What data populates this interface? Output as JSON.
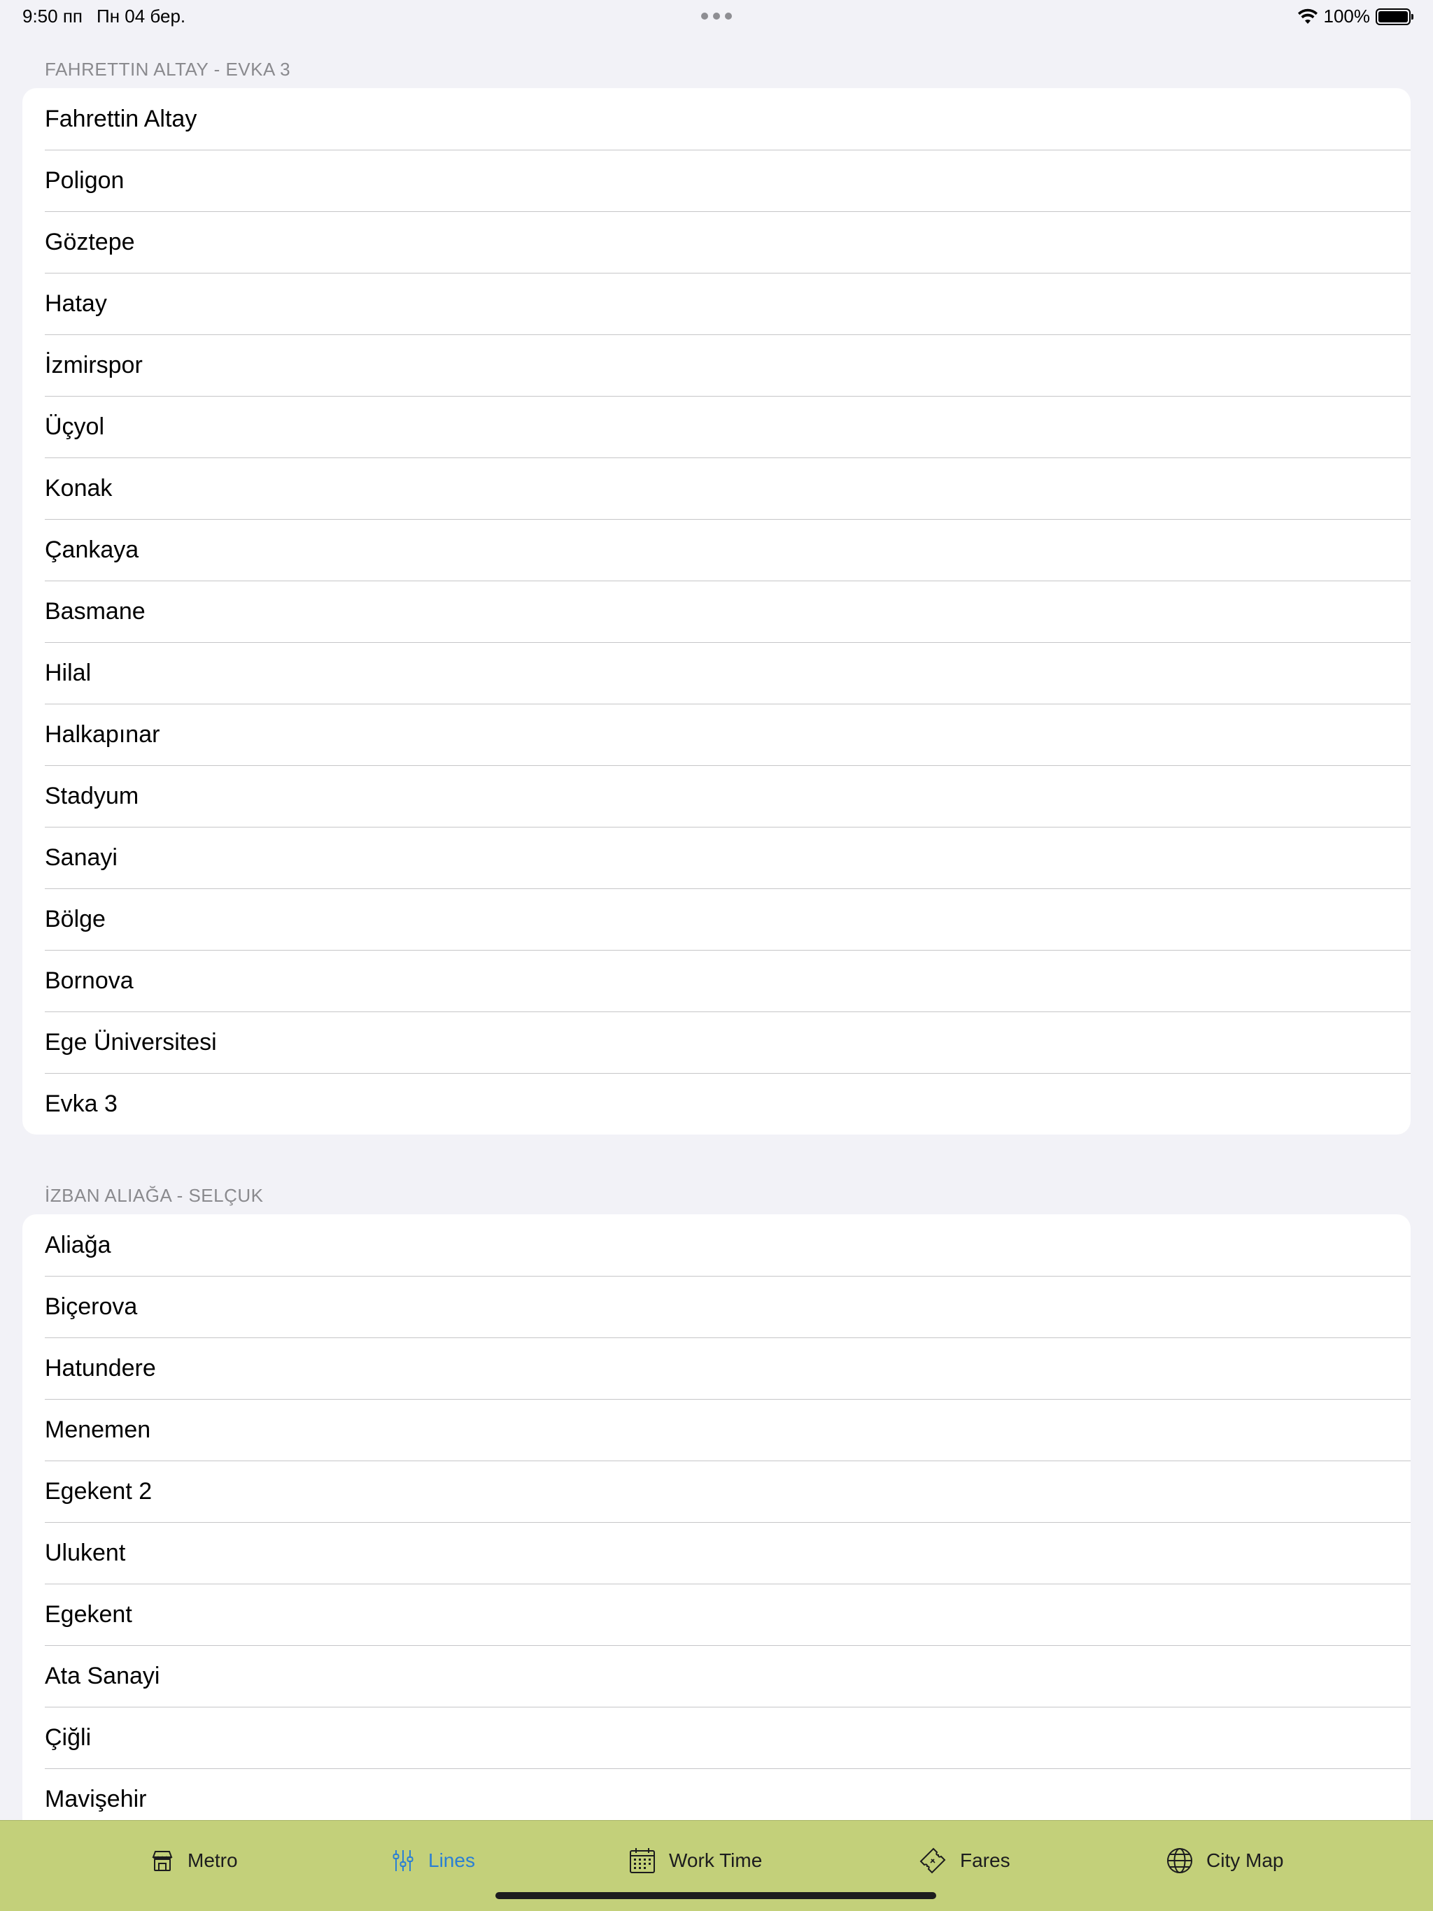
{
  "status_bar": {
    "time": "9:50 пп",
    "date": "Пн 04 бер.",
    "battery_text": "100%"
  },
  "sections": [
    {
      "header": "FAHRETTIN ALTAY - EVKA 3",
      "stations": [
        "Fahrettin Altay",
        "Poligon",
        "Göztepe",
        "Hatay",
        "İzmirspor",
        "Üçyol",
        "Konak",
        "Çankaya",
        "Basmane",
        "Hilal",
        "Halkapınar",
        "Stadyum",
        "Sanayi",
        "Bölge",
        "Bornova",
        "Ege Üniversitesi",
        "Evka 3"
      ]
    },
    {
      "header": "İZBAN ALIAĞA - SELÇUK",
      "stations": [
        "Aliağa",
        "Biçerova",
        "Hatundere",
        "Menemen",
        "Egekent 2",
        "Ulukent",
        "Egekent",
        "Ata Sanayi",
        "Çiğli",
        "Mavişehir"
      ]
    }
  ],
  "tab_bar": {
    "background": "#c3d07a",
    "active_color": "#2a7fd4",
    "tabs": [
      {
        "label": "Metro",
        "icon": "metro-icon",
        "active": false
      },
      {
        "label": "Lines",
        "icon": "lines-icon",
        "active": true
      },
      {
        "label": "Work Time",
        "icon": "calendar-icon",
        "active": false
      },
      {
        "label": "Fares",
        "icon": "ticket-icon",
        "active": false
      },
      {
        "label": "City Map",
        "icon": "globe-icon",
        "active": false
      }
    ]
  }
}
